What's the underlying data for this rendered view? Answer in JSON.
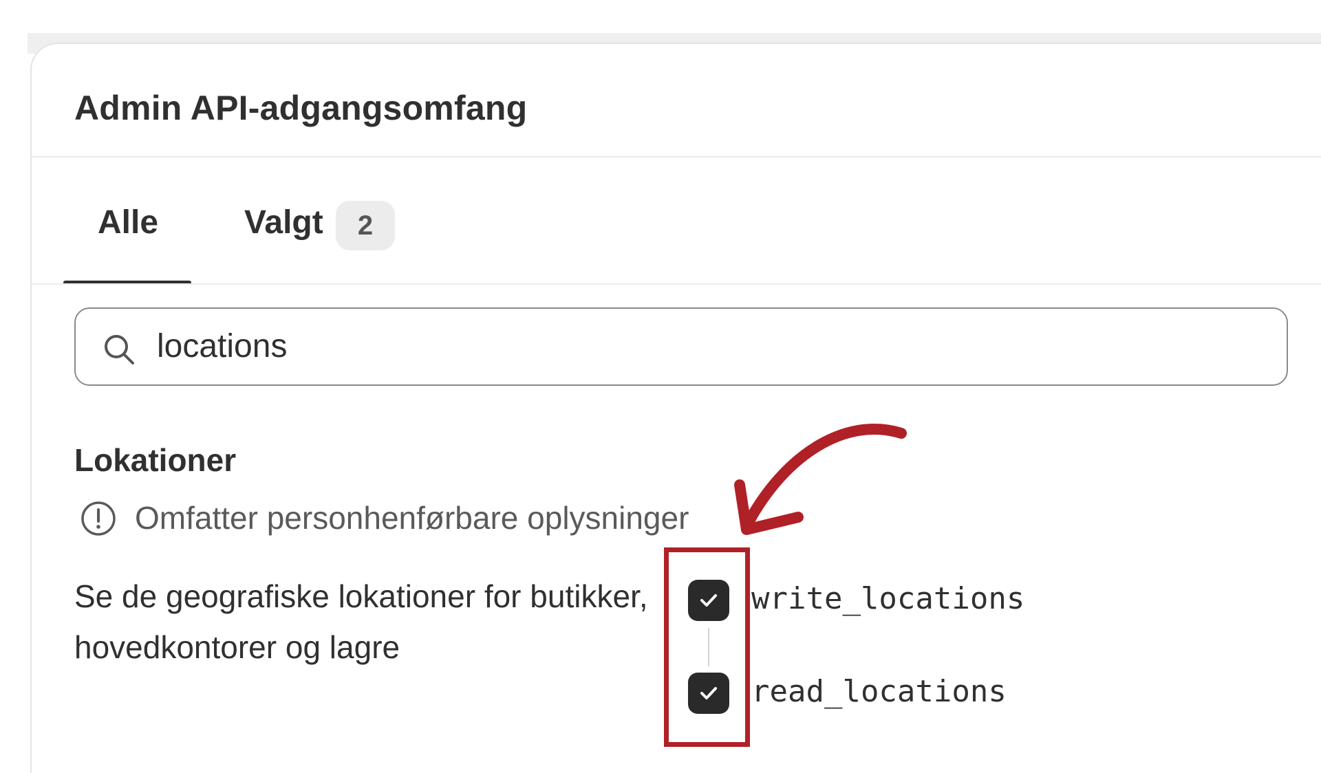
{
  "card": {
    "title": "Admin API-adgangsomfang"
  },
  "tabs": [
    {
      "label": "Alle",
      "selected": true
    },
    {
      "label": "Valgt",
      "badge": "2",
      "selected": false
    }
  ],
  "search": {
    "value": "locations",
    "icon": "search-icon"
  },
  "section": {
    "title": "Lokationer",
    "notice": "Omfatter personhenførbare oplysninger",
    "notice_icon": "info-icon",
    "description": "Se de geografiske lokationer for butikker, hovedkontorer og lagre"
  },
  "scopes": [
    {
      "name": "write_locations",
      "checked": true
    },
    {
      "name": "read_locations",
      "checked": true
    }
  ],
  "annotation": {
    "color": "#b02127",
    "arrow_icon": "curved-arrow-icon"
  }
}
